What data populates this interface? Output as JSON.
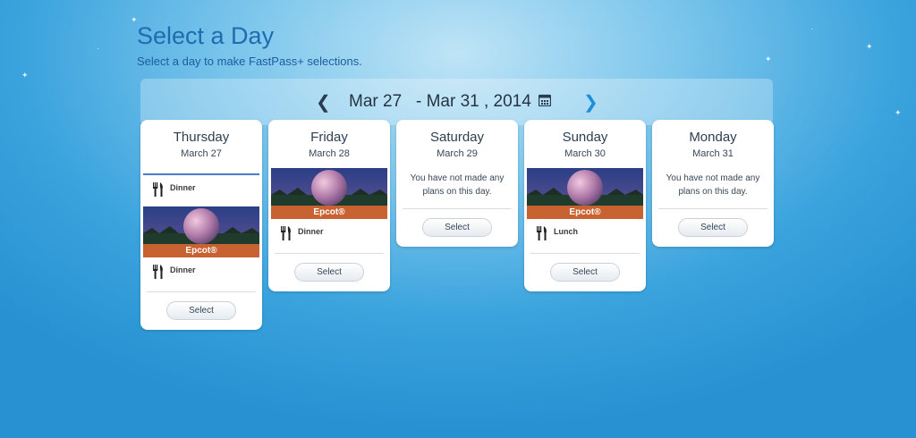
{
  "page": {
    "title": "Select a Day",
    "subtitle": "Select a day to make FastPass+ selections."
  },
  "date_range": {
    "label": "Mar 27   - Mar 31 , 2014",
    "prev_icon": "chevron-left-icon",
    "next_icon": "chevron-right-icon",
    "calendar_icon": "calendar-icon"
  },
  "days": [
    {
      "name": "Thursday",
      "date": "March 27",
      "plans_top": [
        {
          "icon": "fork-knife-icon",
          "label": "Dinner"
        }
      ],
      "park": {
        "label": "Epcot®"
      },
      "plans_bottom": [
        {
          "icon": "fork-knife-icon",
          "label": "Dinner"
        }
      ],
      "button": "Select"
    },
    {
      "name": "Friday",
      "date": "March 28",
      "park": {
        "label": "Epcot®"
      },
      "plans_bottom": [
        {
          "icon": "fork-knife-icon",
          "label": "Dinner"
        }
      ],
      "button": "Select"
    },
    {
      "name": "Saturday",
      "date": "March 29",
      "empty_text": "You have not made any plans on this day.",
      "button": "Select"
    },
    {
      "name": "Sunday",
      "date": "March 30",
      "park": {
        "label": "Epcot®"
      },
      "plans_bottom": [
        {
          "icon": "fork-knife-icon",
          "label": "Lunch"
        }
      ],
      "button": "Select"
    },
    {
      "name": "Monday",
      "date": "March 31",
      "empty_text": "You have not made any plans on this day.",
      "button": "Select"
    }
  ],
  "colors": {
    "title": "#1f6bb0",
    "park_band": "#c86230",
    "next_arrow": "#1d8fd8",
    "accent_rule": "#4a7dc9"
  }
}
